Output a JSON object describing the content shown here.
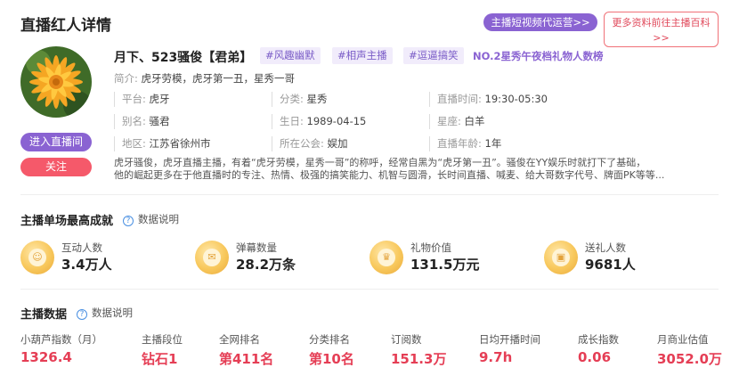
{
  "header": {
    "title": "直播红人详情",
    "service_btn": "主播短视频代运营>>",
    "baike_btn_line1": "更多资料前往主播百科",
    "baike_btn_line2": ">>"
  },
  "profile": {
    "name": "月下、523骚俊【君弟】",
    "tags": [
      "#风趣幽默",
      "#相声主播",
      "#逗逼搞笑"
    ],
    "rank_link": "NO.2星秀午夜档礼物人数榜",
    "intro_label": "简介:",
    "intro_value": "虎牙劳模，虎牙第一丑，星秀一哥",
    "live_btn": "进入直播间",
    "follow_btn": "关注",
    "info": [
      {
        "label": "平台:",
        "value": "虎牙"
      },
      {
        "label": "分类:",
        "value": "星秀"
      },
      {
        "label": "直播时间:",
        "value": "19:30-05:30"
      },
      {
        "label": "别名:",
        "value": "骚君"
      },
      {
        "label": "生日:",
        "value": "1989-04-15"
      },
      {
        "label": "星座:",
        "value": "白羊"
      },
      {
        "label": "地区:",
        "value": "江苏省徐州市"
      },
      {
        "label": "所在公会:",
        "value": "娱加"
      },
      {
        "label": "直播年龄:",
        "value": "1年"
      }
    ],
    "description_line1": "虎牙骚俊，虎牙直播主播，有着“虎牙劳模，星秀一哥”的称呼，经常自黑为“虎牙第一丑”。骚俊在YY娱乐时就打下了基础，",
    "description_line2": "他的崛起更多在于他直播时的专注、热情、极强的搞笑能力、机智与圆滑，长时间直播、喊麦、给大哥数字代号、牌面PK等等..."
  },
  "achievements": {
    "title": "主播单场最高成就",
    "help": "数据说明",
    "items": [
      {
        "label": "互动人数",
        "value": "3.4万人",
        "icon": "user-group-icon"
      },
      {
        "label": "弹幕数量",
        "value": "28.2万条",
        "icon": "chat-icon"
      },
      {
        "label": "礼物价值",
        "value": "131.5万元",
        "icon": "crown-icon"
      },
      {
        "label": "送礼人数",
        "value": "9681人",
        "icon": "gift-icon"
      }
    ]
  },
  "anchor_data": {
    "title": "主播数据",
    "help": "数据说明",
    "metrics": [
      {
        "label": "小葫芦指数（月）",
        "value": "1326.4"
      },
      {
        "label": "主播段位",
        "value": "钻石1"
      },
      {
        "label": "全网排名",
        "value": "第411名"
      },
      {
        "label": "分类排名",
        "value": "第10名"
      },
      {
        "label": "订阅数",
        "value": "151.3万"
      },
      {
        "label": "日均开播时间",
        "value": "9.7h"
      },
      {
        "label": "成长指数",
        "value": "0.06"
      },
      {
        "label": "月商业估值",
        "value": "3052.0万"
      }
    ]
  }
}
